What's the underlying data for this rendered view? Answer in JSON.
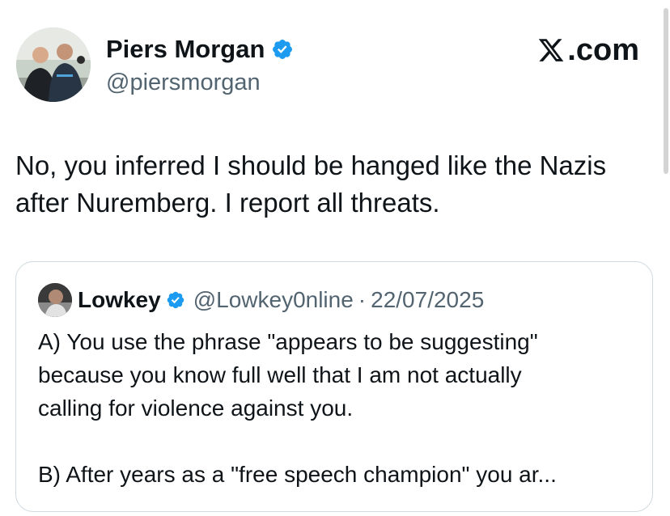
{
  "tweet": {
    "author_name": "Piers Morgan",
    "author_handle": "@piersmorgan",
    "verified": true,
    "brand": ".com",
    "brand_icon": "x-logo-icon",
    "text": "No, you inferred I should be hanged like the Nazis\nafter Nuremberg. I report all threats."
  },
  "quoted_tweet": {
    "author_name": "Lowkey",
    "author_handle": "@Lowkey0nline",
    "separator": "·",
    "date": "22/07/2025",
    "verified": true,
    "paragraphs": [
      "A) You use the phrase \"appears to be suggesting\"\nbecause you know full well that I am not actually\ncalling for violence against you.",
      "B) After years as a \"free speech champion\" you ar..."
    ]
  },
  "colors": {
    "text_primary": "#0f1419",
    "text_secondary": "#536471",
    "verified_blue": "#1d9bf0",
    "card_border": "#cfd9de"
  }
}
